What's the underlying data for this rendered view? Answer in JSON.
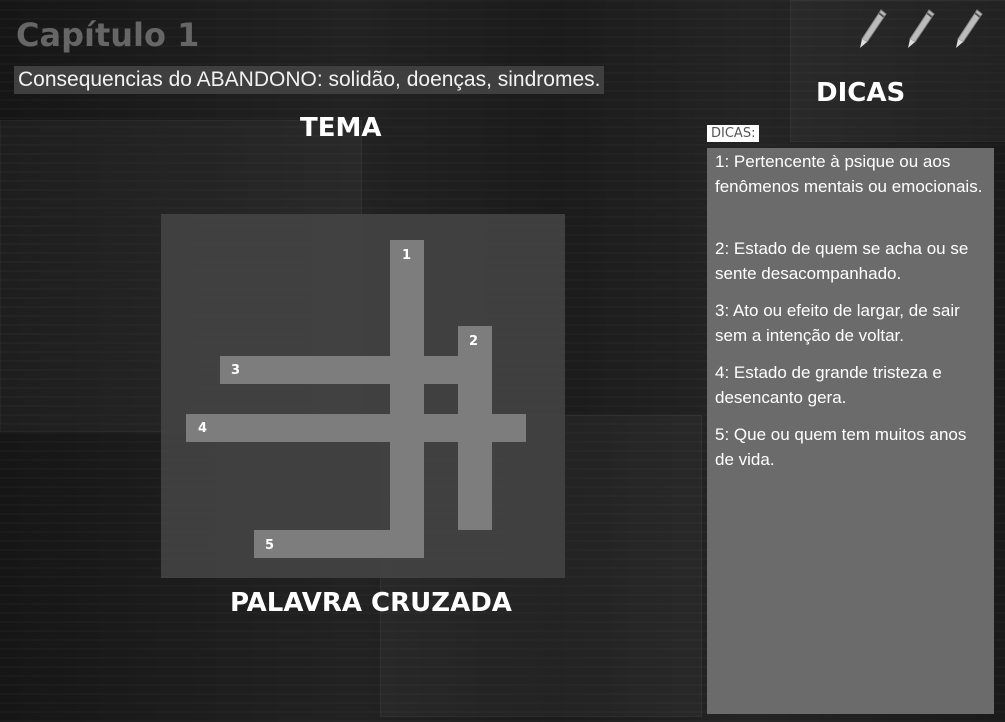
{
  "header": {
    "chapter": "Capítulo 1",
    "subtitle": "Consequencias do ABANDONO: solidão, doenças, sindromes."
  },
  "sections": {
    "theme": "TEMA",
    "crossword": "PALAVRA CRUZADA",
    "hints": "DICAS"
  },
  "hints_panel": {
    "tag": "DICAS:",
    "items": [
      "1: Pertencente à psique ou aos fenômenos mentais ou emocionais.",
      "2: Estado de quem se acha ou se sente desacompanhado.",
      "3: Ato ou efeito de largar, de sair sem a intenção de voltar.",
      "4: Estado de grande tristeza e desencanto gera.",
      "5: Que ou quem tem muitos anos de vida."
    ]
  },
  "crossword": {
    "numbers": [
      "1",
      "2",
      "3",
      "4",
      "5"
    ]
  },
  "icons": [
    "pen-icon",
    "pen-icon",
    "pen-icon"
  ]
}
